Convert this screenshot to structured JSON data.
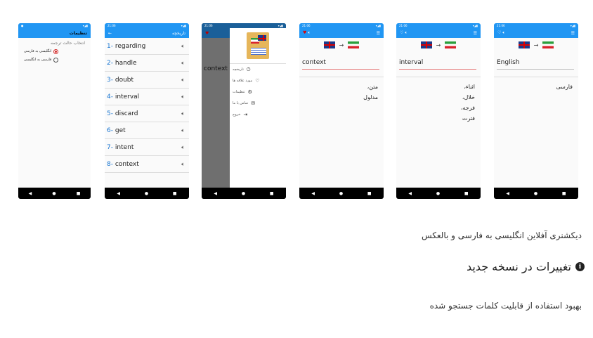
{
  "screens": {
    "settings": {
      "title": "تنظیمات",
      "section_title": "انتخاب حالت ترجمه",
      "options": [
        "انگلیسی به فارسی",
        "فارسی به انگلیسی"
      ]
    },
    "history": {
      "title": "تاریخچه",
      "items": [
        {
          "num": "1-",
          "word": "regarding"
        },
        {
          "num": "2-",
          "word": "handle"
        },
        {
          "num": "3-",
          "word": "doubt"
        },
        {
          "num": "4-",
          "word": "interval"
        },
        {
          "num": "5-",
          "word": "discard"
        },
        {
          "num": "6-",
          "word": "get"
        },
        {
          "num": "7-",
          "word": "intent"
        },
        {
          "num": "8-",
          "word": "context"
        }
      ]
    },
    "drawer": {
      "behind_text": "context",
      "items": [
        "تاریخچه",
        "مورد علاقه ها",
        "تنظیمات",
        "تماس با ما",
        "خروج"
      ]
    },
    "result1": {
      "input": "context",
      "meanings": [
        "متن،",
        "مدلول"
      ]
    },
    "result2": {
      "input": "interval",
      "meanings": [
        "اثناء،",
        "خلال،",
        "فرجه،",
        "فترت"
      ]
    },
    "result3": {
      "input": "English",
      "meanings": [
        "فارسی"
      ]
    }
  },
  "status_time": "21:06",
  "description": "دیکشنری آفلاین انگلیسی به فارسی و بالعکس",
  "whats_new": {
    "heading": "تغییرات در نسخه جدید",
    "body": "بهبود استفاده از قابلیت کلمات جستجو شده"
  }
}
